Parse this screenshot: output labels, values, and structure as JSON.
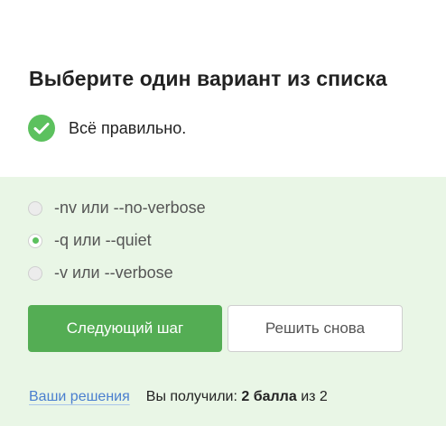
{
  "question": {
    "title": "Выберите один вариант из списка",
    "status_text": "Всё правильно.",
    "status_icon": "check-circle-icon"
  },
  "options": [
    {
      "label": "-nv или --no-verbose",
      "selected": false
    },
    {
      "label": "-q или --quiet",
      "selected": true
    },
    {
      "label": "-v или --verbose",
      "selected": false
    }
  ],
  "buttons": {
    "next_label": "Следующий шаг",
    "retry_label": "Решить снова"
  },
  "footer": {
    "solutions_link": "Ваши решения",
    "score_prefix": "Вы получили:",
    "score_value": "2 балла",
    "score_suffix": "из 2"
  },
  "colors": {
    "accent_green": "#5cc15e",
    "button_green": "#54ad54",
    "answer_background": "#e9f6e6",
    "link_blue": "#4a7fcf"
  }
}
